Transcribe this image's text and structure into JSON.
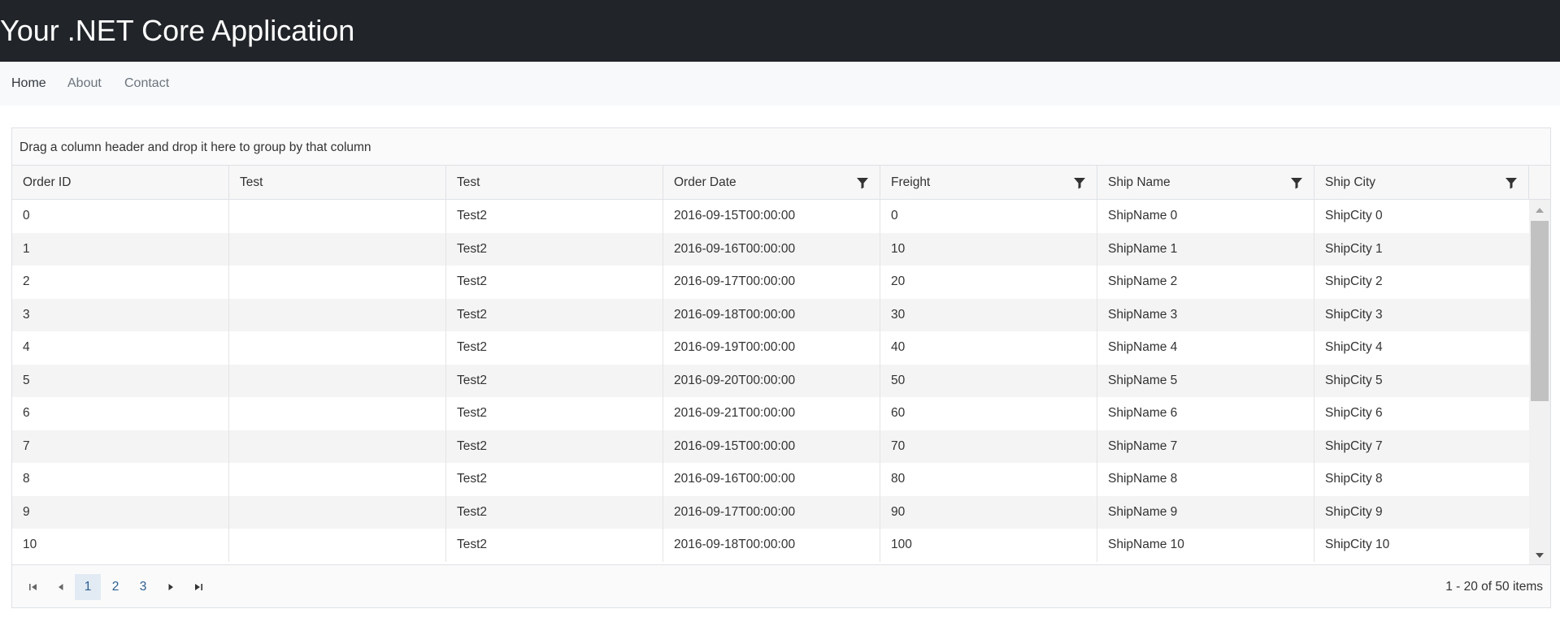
{
  "header": {
    "title": "Your .NET Core Application"
  },
  "nav": {
    "items": [
      {
        "label": "Home",
        "active": true
      },
      {
        "label": "About",
        "active": false
      },
      {
        "label": "Contact",
        "active": false
      }
    ]
  },
  "grid": {
    "group_panel_text": "Drag a column header and drop it here to group by that column",
    "columns": [
      {
        "title": "Order ID",
        "filterable": false
      },
      {
        "title": "Test",
        "filterable": false
      },
      {
        "title": "Test",
        "filterable": false
      },
      {
        "title": "Order Date",
        "filterable": true
      },
      {
        "title": "Freight",
        "filterable": true
      },
      {
        "title": "Ship Name",
        "filterable": true
      },
      {
        "title": "Ship City",
        "filterable": true
      }
    ],
    "rows": [
      [
        "0",
        "",
        "Test2",
        "2016-09-15T00:00:00",
        "0",
        "ShipName 0",
        "ShipCity 0"
      ],
      [
        "1",
        "",
        "Test2",
        "2016-09-16T00:00:00",
        "10",
        "ShipName 1",
        "ShipCity 1"
      ],
      [
        "2",
        "",
        "Test2",
        "2016-09-17T00:00:00",
        "20",
        "ShipName 2",
        "ShipCity 2"
      ],
      [
        "3",
        "",
        "Test2",
        "2016-09-18T00:00:00",
        "30",
        "ShipName 3",
        "ShipCity 3"
      ],
      [
        "4",
        "",
        "Test2",
        "2016-09-19T00:00:00",
        "40",
        "ShipName 4",
        "ShipCity 4"
      ],
      [
        "5",
        "",
        "Test2",
        "2016-09-20T00:00:00",
        "50",
        "ShipName 5",
        "ShipCity 5"
      ],
      [
        "6",
        "",
        "Test2",
        "2016-09-21T00:00:00",
        "60",
        "ShipName 6",
        "ShipCity 6"
      ],
      [
        "7",
        "",
        "Test2",
        "2016-09-15T00:00:00",
        "70",
        "ShipName 7",
        "ShipCity 7"
      ],
      [
        "8",
        "",
        "Test2",
        "2016-09-16T00:00:00",
        "80",
        "ShipName 8",
        "ShipCity 8"
      ],
      [
        "9",
        "",
        "Test2",
        "2016-09-17T00:00:00",
        "90",
        "ShipName 9",
        "ShipCity 9"
      ],
      [
        "10",
        "",
        "Test2",
        "2016-09-18T00:00:00",
        "100",
        "ShipName 10",
        "ShipCity 10"
      ]
    ],
    "pager": {
      "pages": [
        "1",
        "2",
        "3"
      ],
      "current_page": "1",
      "info": "1 - 20 of 50 items",
      "icons": [
        "seek-first-icon",
        "arrow-left-icon",
        "arrow-right-icon",
        "seek-last-icon"
      ]
    },
    "colors": {
      "header_bar": "#212529",
      "nav_bar": "#f8f9fa",
      "selected_page": "#e2ebf3",
      "link": "#2c5e8f",
      "alt_row": "#f4f4f4"
    }
  }
}
